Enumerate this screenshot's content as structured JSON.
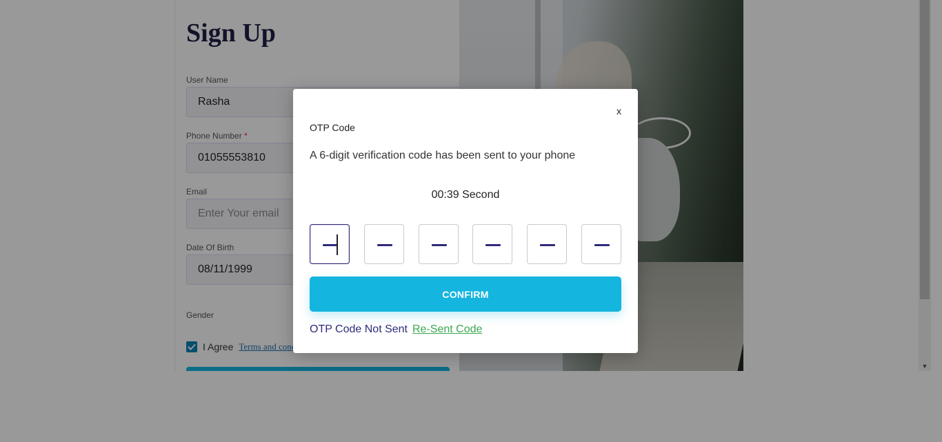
{
  "signup": {
    "title": "Sign Up",
    "username": {
      "label": "User Name",
      "value": "Rasha"
    },
    "phone": {
      "label": "Phone Number",
      "required_mark": "*",
      "value": "01055553810"
    },
    "email": {
      "label": "Email",
      "placeholder": "Enter Your email"
    },
    "dob": {
      "label": "Date Of Birth",
      "value": "08/11/1999"
    },
    "gender": {
      "label": "Gender"
    },
    "agree": {
      "prefix": "I Agree",
      "link": "Terms and cond"
    }
  },
  "modal": {
    "close_label": "x",
    "title": "OTP Code",
    "description": "A 6-digit verification code has been sent to your phone",
    "timer": "00:39 Second",
    "confirm_label": "CONFIRM",
    "not_sent_text": "OTP Code Not Sent",
    "resend_label": "Re-Sent Code"
  },
  "icons": {
    "checkbox": "checkmark-icon",
    "scroll_down": "chevron-down-icon"
  },
  "colors": {
    "accent": "#14b5de",
    "navy": "#2e2a7a",
    "link_green": "#3aa851",
    "title_navy": "#1f2147"
  }
}
